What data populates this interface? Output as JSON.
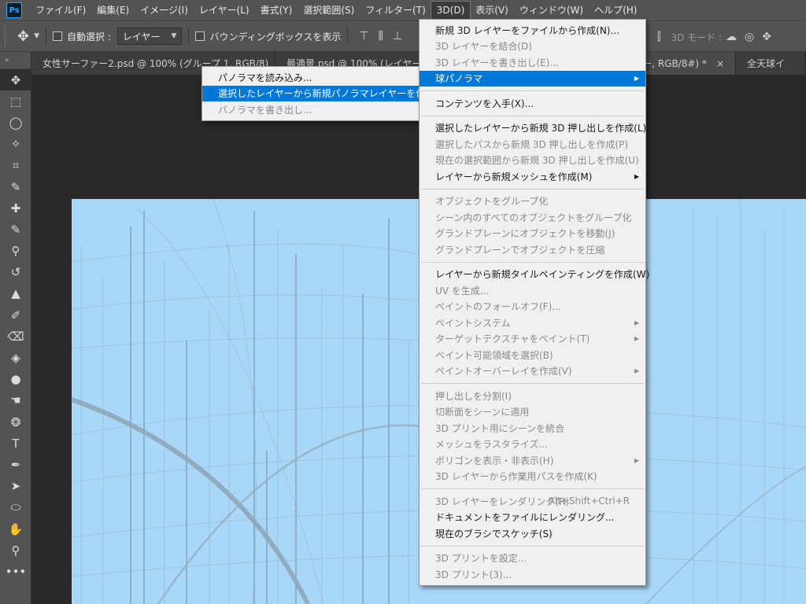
{
  "app": {
    "logo_text": "Ps",
    "menus": [
      "ファイル(F)",
      "編集(E)",
      "イメージ(I)",
      "レイヤー(L)",
      "書式(Y)",
      "選択範囲(S)",
      "フィルター(T)",
      "3D(D)",
      "表示(V)",
      "ウィンドウ(W)",
      "ヘルプ(H)"
    ],
    "active_menu": "3D(D)"
  },
  "options_bar": {
    "auto_select_label": "自動選択 :",
    "auto_select_value": "レイヤー",
    "bounding_box_label": "バウンディングボックスを表示",
    "mode_3d_label": "3D モード :"
  },
  "tabs": [
    {
      "label": "女性サーファー2.psd @ 100% (グループ 1, RGB/8)",
      "close": "×"
    },
    {
      "label": "最適景.psd @ 100% (レイヤー",
      "close": "×"
    },
    {
      "label": "0 のコピー, RGB/8#) *",
      "close": "×"
    },
    {
      "label": "全天球イ",
      "close": ""
    }
  ],
  "menu_3d": {
    "items": [
      {
        "label": "新規 3D レイヤーをファイルから作成(N)...",
        "state": "enabled"
      },
      {
        "label": "3D レイヤーを結合(D)",
        "state": "disabled"
      },
      {
        "label": "3D レイヤーを書き出し(E)...",
        "state": "disabled"
      },
      {
        "label": "球パノラマ",
        "state": "highlight",
        "submenu": true
      },
      {
        "separator": true
      },
      {
        "label": "コンテンツを入手(X)...",
        "state": "enabled"
      },
      {
        "separator": true
      },
      {
        "label": "選択したレイヤーから新規 3D 押し出しを作成(L)",
        "state": "enabled"
      },
      {
        "label": "選択したパスから新規 3D 押し出しを作成(P)",
        "state": "disabled"
      },
      {
        "label": "現在の選択範囲から新規 3D 押し出しを作成(U)",
        "state": "disabled"
      },
      {
        "label": "レイヤーから新規メッシュを作成(M)",
        "state": "enabled",
        "submenu": true
      },
      {
        "separator": true
      },
      {
        "label": "オブジェクトをグループ化",
        "state": "disabled"
      },
      {
        "label": "シーン内のすべてのオブジェクトをグループ化",
        "state": "disabled"
      },
      {
        "label": "グランドプレーンにオブジェクトを移動(J)",
        "state": "disabled"
      },
      {
        "label": "グランドプレーンでオブジェクトを圧縮",
        "state": "disabled"
      },
      {
        "separator": true
      },
      {
        "label": "レイヤーから新規タイルペインティングを作成(W)",
        "state": "enabled"
      },
      {
        "label": "UV を生成...",
        "state": "disabled"
      },
      {
        "label": "ペイントのフォールオフ(F)...",
        "state": "disabled"
      },
      {
        "label": "ペイントシステム",
        "state": "disabled",
        "submenu": true
      },
      {
        "label": "ターゲットテクスチャをペイント(T)",
        "state": "disabled",
        "submenu": true
      },
      {
        "label": "ペイント可能領域を選択(B)",
        "state": "disabled"
      },
      {
        "label": "ペイントオーバーレイを作成(V)",
        "state": "disabled",
        "submenu": true
      },
      {
        "separator": true
      },
      {
        "label": "押し出しを分割(I)",
        "state": "disabled"
      },
      {
        "label": "切断面をシーンに適用",
        "state": "disabled"
      },
      {
        "label": "3D プリント用にシーンを統合",
        "state": "disabled"
      },
      {
        "label": "メッシュをラスタライズ...",
        "state": "disabled"
      },
      {
        "label": "ポリゴンを表示・非表示(H)",
        "state": "disabled",
        "submenu": true
      },
      {
        "label": "3D レイヤーから作業用パスを作成(K)",
        "state": "disabled"
      },
      {
        "separator": true
      },
      {
        "label": "3D レイヤーをレンダリング(R)",
        "state": "disabled",
        "shortcut": "Alt+Shift+Ctrl+R"
      },
      {
        "label": "ドキュメントをファイルにレンダリング...",
        "state": "enabled"
      },
      {
        "label": "現在のブラシでスケッチ(S)",
        "state": "enabled"
      },
      {
        "separator": true
      },
      {
        "label": "3D プリントを設定...",
        "state": "disabled"
      },
      {
        "label": "3D プリント(3)...",
        "state": "disabled"
      }
    ]
  },
  "submenu_panorama": {
    "items": [
      {
        "label": "パノラマを読み込み...",
        "state": "enabled"
      },
      {
        "label": "選択したレイヤーから新規パノラマレイヤーを作成",
        "state": "highlight"
      },
      {
        "label": "パノラマを書き出し...",
        "state": "disabled"
      }
    ]
  },
  "toolbar": {
    "collapse_glyph": "»",
    "tools": [
      {
        "name": "move-tool-icon",
        "glyph": "✥",
        "active": true
      },
      {
        "name": "marquee-tool-icon",
        "glyph": "⬚"
      },
      {
        "name": "lasso-tool-icon",
        "glyph": "◯"
      },
      {
        "name": "magic-wand-tool-icon",
        "glyph": "✧"
      },
      {
        "name": "crop-tool-icon",
        "glyph": "⌗"
      },
      {
        "name": "eyedropper-tool-icon",
        "glyph": "✎"
      },
      {
        "name": "healing-brush-tool-icon",
        "glyph": "✚"
      },
      {
        "name": "brush-tool-icon",
        "glyph": "✎"
      },
      {
        "name": "clone-stamp-tool-icon",
        "glyph": "⚲"
      },
      {
        "name": "history-brush-tool-icon",
        "glyph": "↺"
      },
      {
        "name": "stamp-tool-icon",
        "glyph": "▲"
      },
      {
        "name": "art-history-tool-icon",
        "glyph": "✐"
      },
      {
        "name": "eraser-tool-icon",
        "glyph": "⌫"
      },
      {
        "name": "paint-bucket-tool-icon",
        "glyph": "◈"
      },
      {
        "name": "blur-tool-icon",
        "glyph": "●"
      },
      {
        "name": "smudge-tool-icon",
        "glyph": "☚"
      },
      {
        "name": "sponge-tool-icon",
        "glyph": "❂"
      },
      {
        "name": "type-tool-icon",
        "glyph": "T"
      },
      {
        "name": "pen-tool-icon",
        "glyph": "✒"
      },
      {
        "name": "path-selection-tool-icon",
        "glyph": "➤"
      },
      {
        "name": "ellipse-tool-icon",
        "glyph": "⬭"
      },
      {
        "name": "hand-tool-icon",
        "glyph": "✋"
      },
      {
        "name": "zoom-tool-icon",
        "glyph": "⚲"
      },
      {
        "name": "more-tools-icon",
        "glyph": "•••"
      }
    ]
  },
  "colors": {
    "ui_dark": "#535353",
    "workspace": "#282828",
    "canvas": "#a9d7f7",
    "menu_bg": "#f0f0f0",
    "highlight": "#0078d7"
  }
}
